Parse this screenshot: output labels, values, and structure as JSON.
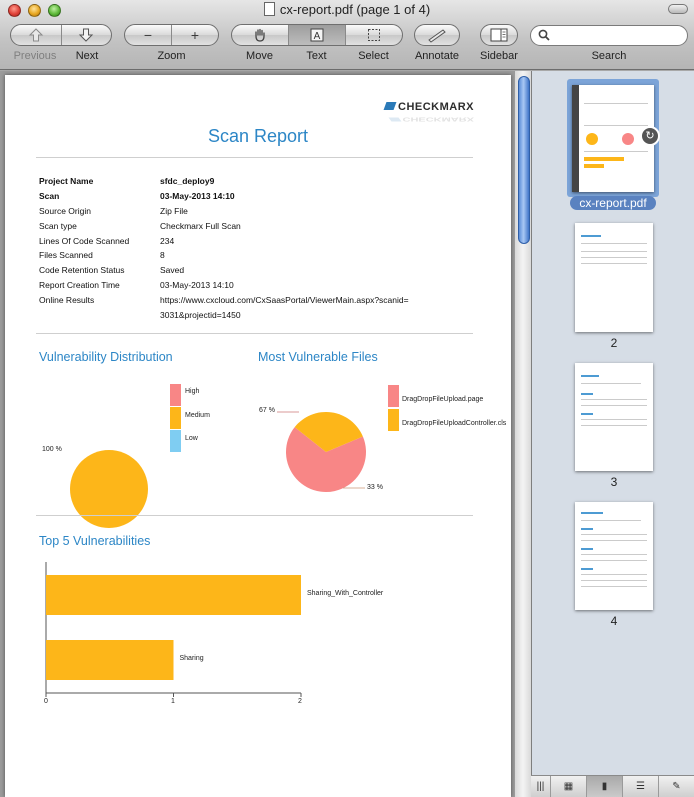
{
  "window": {
    "title": "cx-report.pdf (page 1 of 4)"
  },
  "toolbar": {
    "previous_label": "Previous",
    "next_label": "Next",
    "zoom_label": "Zoom",
    "zoom_out_glyph": "−",
    "zoom_in_glyph": "+",
    "move_label": "Move",
    "text_label": "Text",
    "select_label": "Select",
    "annotate_label": "Annotate",
    "sidebar_label": "Sidebar",
    "search_label": "Search",
    "search_value": ""
  },
  "report": {
    "logo": "CHECKMARX",
    "title": "Scan Report",
    "fields": [
      {
        "label": "Project Name",
        "value": "sfdc_deploy9"
      },
      {
        "label": "Scan",
        "value": "03-May-2013 14:10"
      },
      {
        "label": "Source Origin",
        "value": "Zip File"
      },
      {
        "label": "Scan type",
        "value": "Checkmarx Full Scan"
      },
      {
        "label": "Lines Of Code Scanned",
        "value": "234"
      },
      {
        "label": "Files Scanned",
        "value": "8"
      },
      {
        "label": "Code Retention Status",
        "value": "Saved"
      },
      {
        "label": "Report Creation Time",
        "value": "03-May-2013 14:10"
      },
      {
        "label": "Online Results",
        "value": "https://www.cxcloud.com/CxSaasPortal/ViewerMain.aspx?scanid=",
        "value2": "3031&projectid=1450"
      }
    ],
    "vuln_dist": {
      "title": "Vulnerability Distribution",
      "slice_label": "100 %",
      "legend": [
        {
          "label": "High",
          "color": "#f88686"
        },
        {
          "label": "Medium",
          "color": "#fdb619"
        },
        {
          "label": "Low",
          "color": "#7fcdf2"
        }
      ]
    },
    "vuln_files": {
      "title": "Most Vulnerable Files",
      "label_a": "67 %",
      "label_b": "33 %",
      "legend": [
        {
          "label": "DragDropFileUpload.page",
          "color": "#f88686"
        },
        {
          "label": "DragDropFileUploadController.cls",
          "color": "#fdb619"
        }
      ]
    },
    "top5": {
      "title": "Top 5 Vulnerabilities",
      "bars": [
        {
          "label": "Sharing_With_Controller",
          "value": 2
        },
        {
          "label": "Sharing",
          "value": 1
        }
      ],
      "ticks": [
        "0",
        "1",
        "2"
      ],
      "color": "#fdb619"
    },
    "page_number": "1"
  },
  "sidebar": {
    "thumbs": [
      {
        "label": "cx-report.pdf"
      },
      {
        "label": "2"
      },
      {
        "label": "3"
      },
      {
        "label": "4"
      }
    ]
  },
  "chart_data": [
    {
      "type": "pie",
      "title": "Vulnerability Distribution",
      "categories": [
        "High",
        "Medium",
        "Low"
      ],
      "values": [
        0,
        100,
        0
      ],
      "data_labels": [
        "",
        "100 %",
        ""
      ],
      "legend": "right"
    },
    {
      "type": "pie",
      "title": "Most Vulnerable Files",
      "categories": [
        "DragDropFileUpload.page",
        "DragDropFileUploadController.cls"
      ],
      "values": [
        67,
        33
      ],
      "data_labels": [
        "67 %",
        "33 %"
      ],
      "legend": "right"
    },
    {
      "type": "bar",
      "orientation": "horizontal",
      "title": "Top 5 Vulnerabilities",
      "categories": [
        "Sharing_With_Controller",
        "Sharing"
      ],
      "values": [
        2,
        1
      ],
      "xlim": [
        0,
        2
      ],
      "ticks": [
        0,
        1,
        2
      ]
    }
  ]
}
